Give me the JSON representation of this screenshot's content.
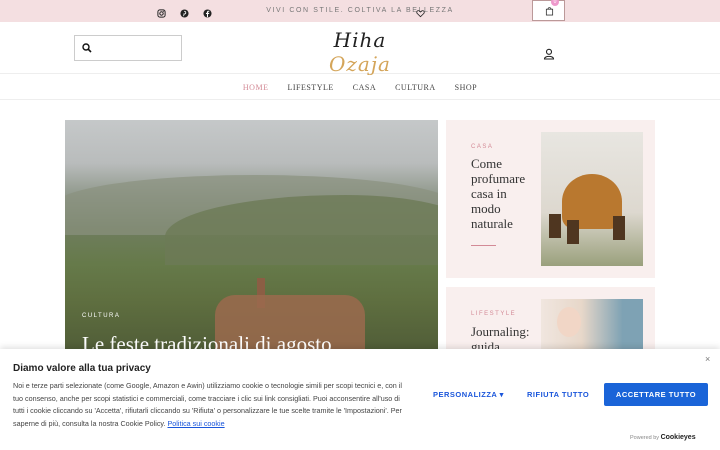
{
  "topbar": {
    "tagline": "VIVI CON STILE. COLTIVA LA BELLEZZA",
    "social_icons": [
      "instagram-icon",
      "pinterest-icon",
      "facebook-icon"
    ],
    "cart_count": "0"
  },
  "header": {
    "logo_main_a": "Hiha",
    "logo_main_b": "Ozaja",
    "logo_sub": "Vivi con stile. Coltiva la bellezza",
    "search_placeholder": ""
  },
  "nav": {
    "items": [
      "HOME",
      "LIFESTYLE",
      "CASA",
      "CULTURA",
      "SHOP"
    ],
    "active": "HOME"
  },
  "hero": {
    "category": "CULTURA",
    "title": "Le feste tradizionali di agosto"
  },
  "cards": [
    {
      "category": "CASA",
      "title": "Come profumare casa in modo naturale"
    },
    {
      "category": "LIFESTYLE",
      "title": "Journaling: guida"
    }
  ],
  "cookie": {
    "title": "Diamo valore alla tua privacy",
    "text": "Noi e terze parti selezionate (come Google, Amazon e Awin) utilizziamo cookie o tecnologie simili per scopi tecnici e, con il tuo consenso, anche per scopi statistici e commerciali, come tracciare i clic sui link consigliati. Puoi acconsentire all'uso di tutti i cookie cliccando su 'Accetta', rifiutarli cliccando su 'Rifiuta' o personalizzare le tue scelte tramite le 'Impostazioni'. Per saperne di più, consulta la nostra Cookie Policy.",
    "link": "Politica sui cookie",
    "personalize": "PERSONALIZZA",
    "reject": "RIFIUTA TUTTO",
    "accept": "ACCETTARE TUTTO",
    "powered_prefix": "Powered by",
    "powered_brand": "Cookieyes",
    "close": "×"
  },
  "colors": {
    "topbar_bg": "#f4dfe1",
    "accent_pink": "#d38a96",
    "accent_gold": "#d4a55a",
    "button_blue": "#1a64d8"
  }
}
